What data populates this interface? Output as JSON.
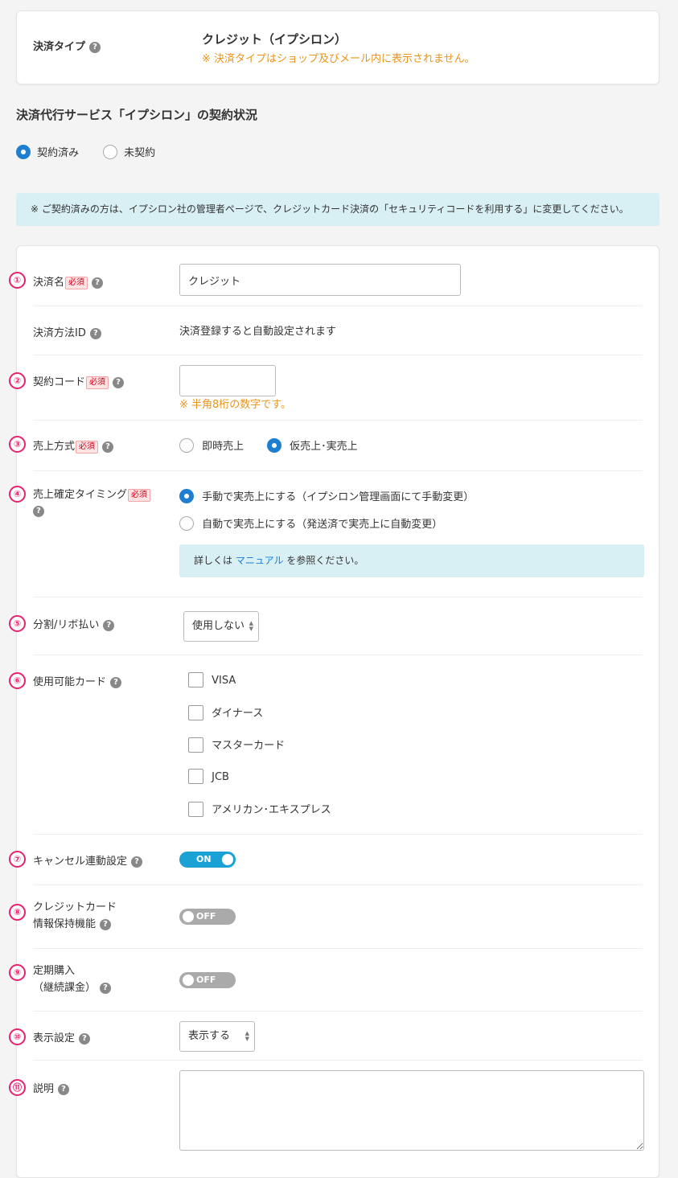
{
  "payment_type": {
    "label": "決済タイプ",
    "value": "クレジット（イプシロン）",
    "note": "※ 決済タイプはショップ及びメール内に表示されません。"
  },
  "contract": {
    "heading": "決済代行サービス「イプシロン」の契約状況",
    "options": [
      "契約済み",
      "未契約"
    ],
    "selected": "契約済み"
  },
  "info_banner": "※ ご契約済みの方は、イプシロン社の管理者ページで、クレジットカード決済の「セキュリティコードを利用する」に変更してください。",
  "required_badge": "必須",
  "help_glyph": "?",
  "numbers": [
    "①",
    "②",
    "③",
    "④",
    "⑤",
    "⑥",
    "⑦",
    "⑧",
    "⑨",
    "⑩",
    "⑪"
  ],
  "fields": {
    "name": {
      "label": "決済名",
      "value": "クレジット"
    },
    "method_id": {
      "label": "決済方法ID",
      "value": "決済登録すると自動設定されます"
    },
    "contract_code": {
      "label": "契約コード",
      "value": "",
      "note": "※ 半角8桁の数字です。"
    },
    "sales_method": {
      "label": "売上方式",
      "options": [
        "即時売上",
        "仮売上･実売上"
      ],
      "selected": "仮売上･実売上"
    },
    "sales_timing": {
      "label": "売上確定タイミング",
      "options": [
        "手動で実売上にする（イプシロン管理画面にて手動変更）",
        "自動で実売上にする（発送済で実売上に自動変更）"
      ],
      "selected": "手動で実売上にする（イプシロン管理画面にて手動変更）",
      "info_prefix": "詳しくは",
      "info_link": "マニュアル",
      "info_suffix": "を参照ください。"
    },
    "installment": {
      "label": "分割/リボ払い",
      "value": "使用しない"
    },
    "cards": {
      "label": "使用可能カード",
      "items": [
        {
          "name": "VISA",
          "checked": false
        },
        {
          "name": "ダイナース",
          "checked": false
        },
        {
          "name": "マスターカード",
          "checked": false
        },
        {
          "name": "JCB",
          "checked": false
        },
        {
          "name": "アメリカン･エキスプレス",
          "checked": false
        }
      ]
    },
    "cancel_link": {
      "label": "キャンセル連動設定",
      "state": "ON"
    },
    "card_retention": {
      "label_line1": "クレジットカード",
      "label_line2": "情報保持機能",
      "state": "OFF"
    },
    "subscription": {
      "label_line1": "定期購入",
      "label_line2": "（継続課金）",
      "state": "OFF"
    },
    "display": {
      "label": "表示設定",
      "value": "表示する"
    },
    "description": {
      "label": "説明",
      "value": ""
    }
  },
  "colors": {
    "accent_blue": "#1e7fd0",
    "toggle_on": "#1aa1d6",
    "note_orange": "#e8941a",
    "required_red": "#d0021b",
    "number_pink": "#e8216e",
    "info_bg": "#d8eff4"
  }
}
